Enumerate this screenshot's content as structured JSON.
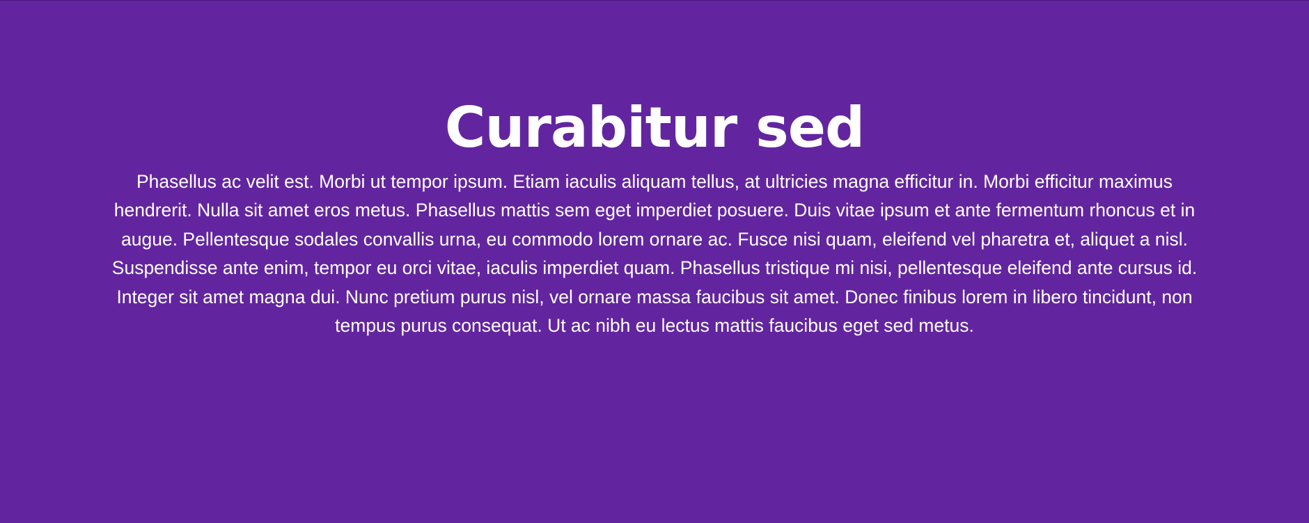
{
  "theme": {
    "background": "#62259f",
    "text_color": "#ffffff"
  },
  "hero": {
    "title": "Curabitur sed",
    "body": "Phasellus ac velit est. Morbi ut tempor ipsum. Etiam iaculis aliquam tellus, at ultricies magna efficitur in. Morbi efficitur maximus hendrerit. Nulla sit amet eros metus. Phasellus mattis sem eget imperdiet posuere. Duis vitae ipsum et ante fermentum rhoncus et in augue. Pellentesque sodales convallis urna, eu commodo lorem ornare ac. Fusce nisi quam, eleifend vel pharetra et, aliquet a nisl. Suspendisse ante enim, tempor eu orci vitae, iaculis imperdiet quam. Phasellus tristique mi nisi, pellentesque eleifend ante cursus id. Integer sit amet magna dui. Nunc pretium purus nisl, vel ornare massa faucibus sit amet. Donec finibus lorem in libero tincidunt, non tempus purus consequat. Ut ac nibh eu lectus mattis faucibus eget sed metus."
  }
}
